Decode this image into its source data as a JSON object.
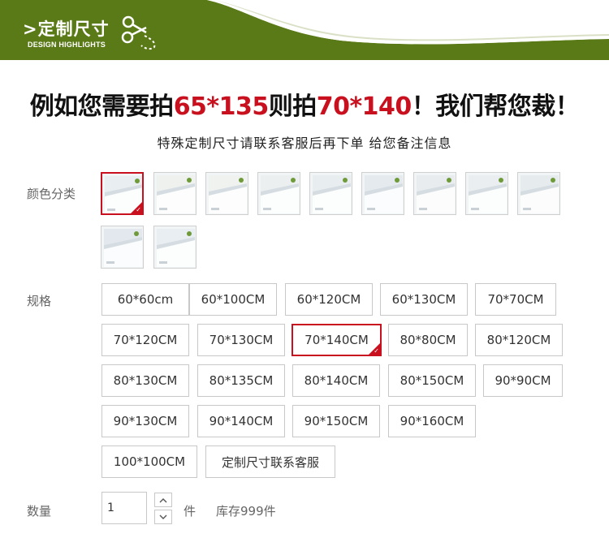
{
  "banner": {
    "title": ">定制尺寸",
    "subtitle": "DESIGN HIGHLIGHTS",
    "colors": {
      "olive": "#5a7a17",
      "light_olive": "#a8b878"
    }
  },
  "headline": {
    "part1": "例如您需要拍",
    "size1": "65*135",
    "part2": "则拍",
    "size2": "70*140",
    "part3": "！我们帮您裁！",
    "accent": "#c8101e"
  },
  "subline": "特殊定制尺寸请联系客服后再下单 给您备注信息",
  "color_section": {
    "label": "颜色分类",
    "swatches": [
      {
        "id": 1,
        "selected": true
      },
      {
        "id": 2,
        "selected": false
      },
      {
        "id": 3,
        "selected": false
      },
      {
        "id": 4,
        "selected": false
      },
      {
        "id": 5,
        "selected": false
      },
      {
        "id": 6,
        "selected": false
      },
      {
        "id": 7,
        "selected": false
      },
      {
        "id": 8,
        "selected": false
      },
      {
        "id": 9,
        "selected": false
      },
      {
        "id": 10,
        "selected": false
      },
      {
        "id": 11,
        "selected": false
      }
    ]
  },
  "size_section": {
    "label": "规格",
    "options": [
      "60*60cm",
      "60*100CM",
      "60*120CM",
      "60*130CM",
      "70*70CM",
      "70*120CM",
      "70*130CM",
      "70*140CM",
      "80*80CM",
      "80*120CM",
      "80*130CM",
      "80*135CM",
      "80*140CM",
      "80*150CM",
      "90*90CM",
      "90*130CM",
      "90*140CM",
      "90*150CM",
      "90*160CM",
      "100*100CM",
      "定制尺寸联系客服"
    ],
    "selected": "70*140CM"
  },
  "quantity": {
    "label": "数量",
    "value": "1",
    "unit": "件",
    "stock": "库存999件"
  }
}
